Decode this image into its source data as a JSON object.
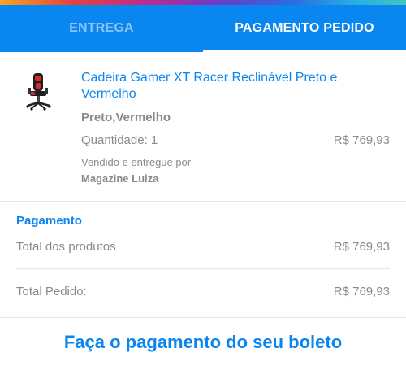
{
  "tabs": [
    {
      "label": "ENTREGA",
      "active": false
    },
    {
      "label": "PAGAMENTO PEDIDO",
      "active": true
    }
  ],
  "product": {
    "name": "Cadeira Gamer XT Racer Reclinável Preto e Vermelho",
    "color": "Preto,Vermelho",
    "quantity": "Quantidade: 1",
    "price": "R$ 769,93",
    "sold_by": "Vendido e entregue por",
    "seller": "Magazine Luiza",
    "image_icon": "gaming-chair-icon"
  },
  "payment": {
    "title": "Pagamento",
    "total_products_label": "Total dos produtos",
    "total_products_value": "R$ 769,93",
    "total_order_label": "Total Pedido:",
    "total_order_value": "R$ 769,93"
  },
  "cta": {
    "label": "Faça o pagamento do seu boleto"
  },
  "colors": {
    "accent": "#0a86f0",
    "muted_text": "#8a8a8a",
    "divider": "#e6e6e6"
  }
}
